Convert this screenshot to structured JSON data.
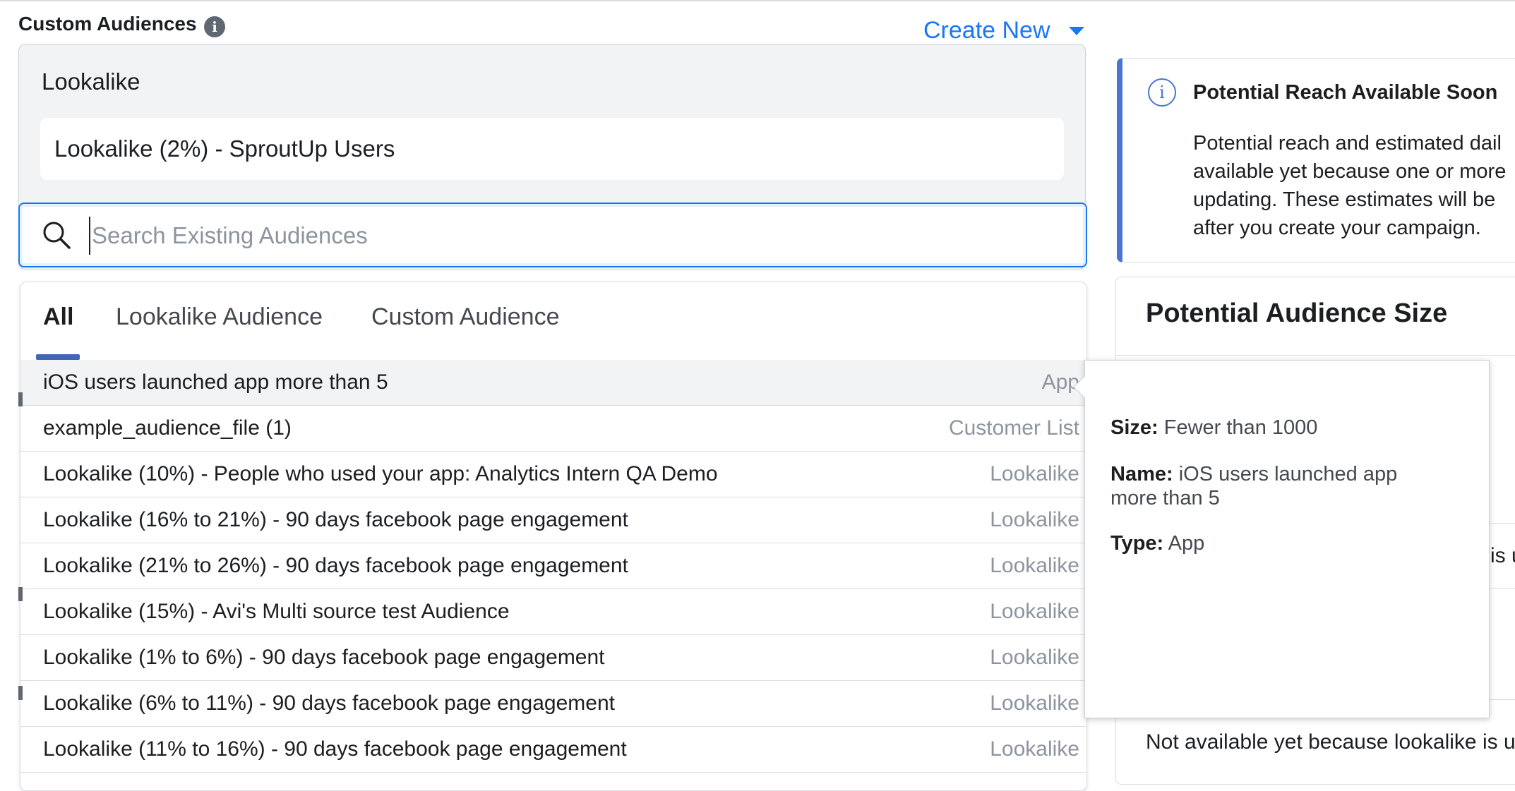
{
  "header": {
    "title": "Custom Audiences",
    "info_icon": "i",
    "create_new": "Create New"
  },
  "selection": {
    "group_label": "Lookalike",
    "selected_item": "Lookalike (2%) - SproutUp Users"
  },
  "search": {
    "placeholder": "Search Existing Audiences",
    "value": ""
  },
  "tabs": [
    {
      "label": "All",
      "active": true
    },
    {
      "label": "Lookalike Audience"
    },
    {
      "label": "Custom Audience"
    }
  ],
  "rows": [
    {
      "name": "iOS users launched app more than 5",
      "type": "App"
    },
    {
      "name": "example_audience_file (1)",
      "type": "Customer List"
    },
    {
      "name": "Lookalike (10%) - People who used your app: Analytics Intern QA Demo",
      "type": "Lookalike"
    },
    {
      "name": "Lookalike (16% to 21%) - 90 days facebook page engagement",
      "type": "Lookalike"
    },
    {
      "name": "Lookalike (21% to 26%) - 90 days facebook page engagement",
      "type": "Lookalike"
    },
    {
      "name": "Lookalike (15%) - Avi's Multi source test Audience",
      "type": "Lookalike"
    },
    {
      "name": "Lookalike (1% to 6%) - 90 days facebook page engagement",
      "type": "Lookalike"
    },
    {
      "name": "Lookalike (6% to 11%) - 90 days facebook page engagement",
      "type": "Lookalike"
    },
    {
      "name": "Lookalike (11% to 16%) - 90 days facebook page engagement",
      "type": "Lookalike"
    }
  ],
  "tooltip": {
    "size_label": "Size:",
    "size_value": "Fewer than 1000",
    "name_label": "Name:",
    "name_value": "iOS users launched app more than 5",
    "type_label": "Type:",
    "type_value": "App"
  },
  "reach_card": {
    "title": "Potential Reach Available Soon",
    "body_lines": [
      "Potential reach and estimated dail",
      "available yet because one or more",
      "updating. These estimates will be",
      "after you create your campaign."
    ]
  },
  "size_card": {
    "title": "Potential Audience Size",
    "fragment": "is u",
    "footer": "Not available yet because lookalike is up"
  },
  "colors": {
    "accent": "#1877f2",
    "tab_underline": "#4267b2",
    "info_border": "#4a75d0"
  }
}
